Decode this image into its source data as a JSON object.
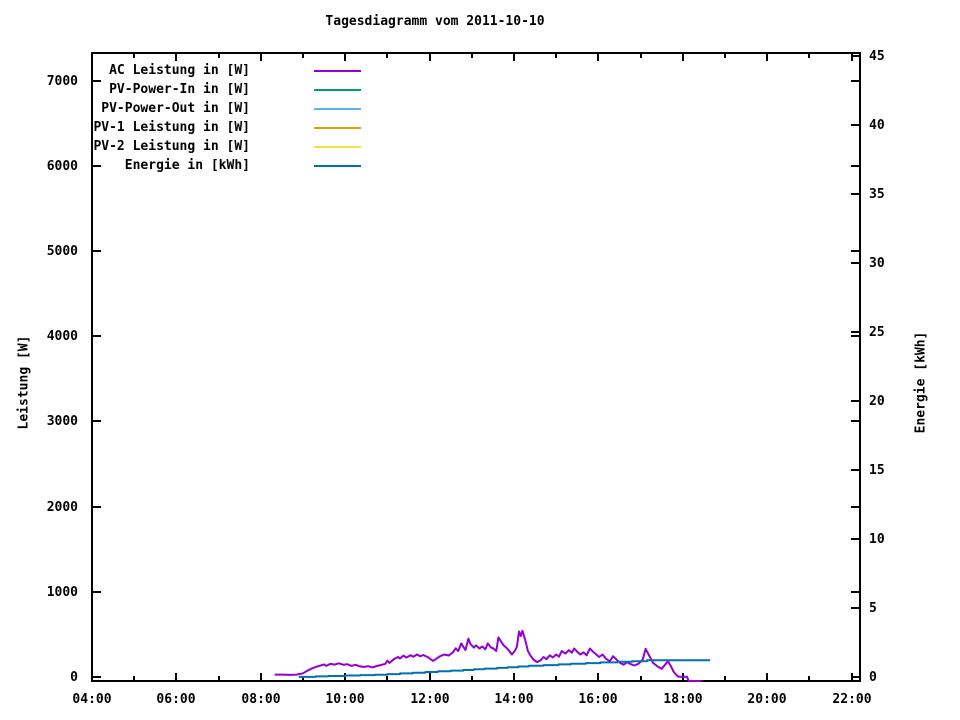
{
  "page": {
    "background": "#ffffff",
    "text_color": "#000000"
  },
  "chart_data": {
    "type": "line",
    "title": "Tagesdiagramm vom 2011-10-10",
    "xlabel": "",
    "ylabel": "Leistung [W]",
    "y2label": "Energie [kWh]",
    "xlim": [
      4,
      22.2
    ],
    "ylim": [
      -50,
      7330
    ],
    "y2lim": [
      -0.3,
      45.2
    ],
    "grid": false,
    "legend_position": "top-left-inside",
    "x_tick_hours": [
      4,
      6,
      8,
      10,
      12,
      14,
      16,
      18,
      20,
      22
    ],
    "x_tick_labels": [
      "04:00",
      "06:00",
      "08:00",
      "10:00",
      "12:00",
      "14:00",
      "16:00",
      "18:00",
      "20:00",
      "22:00"
    ],
    "x_minor_tick_hours": [
      5,
      7,
      9,
      11,
      13,
      15,
      17,
      19,
      21
    ],
    "y_ticks": [
      0,
      1000,
      2000,
      3000,
      4000,
      5000,
      6000,
      7000
    ],
    "y2_ticks": [
      0,
      5,
      10,
      15,
      20,
      25,
      30,
      35,
      40,
      45
    ],
    "series": [
      {
        "name": "AC Leistung in [W]",
        "color": "#9400d3",
        "axis": "y1",
        "step": false,
        "points": [
          [
            8.33,
            25
          ],
          [
            8.5,
            25
          ],
          [
            8.7,
            22
          ],
          [
            8.85,
            25
          ],
          [
            9.0,
            40
          ],
          [
            9.1,
            70
          ],
          [
            9.2,
            95
          ],
          [
            9.3,
            115
          ],
          [
            9.4,
            130
          ],
          [
            9.5,
            145
          ],
          [
            9.55,
            128
          ],
          [
            9.65,
            152
          ],
          [
            9.75,
            143
          ],
          [
            9.85,
            158
          ],
          [
            9.95,
            142
          ],
          [
            10.05,
            148
          ],
          [
            10.15,
            128
          ],
          [
            10.25,
            140
          ],
          [
            10.35,
            122
          ],
          [
            10.45,
            116
          ],
          [
            10.55,
            124
          ],
          [
            10.65,
            110
          ],
          [
            10.75,
            126
          ],
          [
            10.85,
            138
          ],
          [
            10.95,
            152
          ],
          [
            11.0,
            188
          ],
          [
            11.05,
            162
          ],
          [
            11.15,
            205
          ],
          [
            11.25,
            232
          ],
          [
            11.3,
            214
          ],
          [
            11.38,
            248
          ],
          [
            11.45,
            226
          ],
          [
            11.55,
            252
          ],
          [
            11.62,
            236
          ],
          [
            11.7,
            262
          ],
          [
            11.78,
            240
          ],
          [
            11.85,
            256
          ],
          [
            11.95,
            232
          ],
          [
            12.0,
            216
          ],
          [
            12.08,
            186
          ],
          [
            12.15,
            208
          ],
          [
            12.25,
            242
          ],
          [
            12.35,
            262
          ],
          [
            12.45,
            250
          ],
          [
            12.55,
            284
          ],
          [
            12.62,
            334
          ],
          [
            12.68,
            302
          ],
          [
            12.75,
            392
          ],
          [
            12.8,
            352
          ],
          [
            12.85,
            314
          ],
          [
            12.92,
            448
          ],
          [
            12.97,
            384
          ],
          [
            13.05,
            342
          ],
          [
            13.1,
            368
          ],
          [
            13.18,
            332
          ],
          [
            13.25,
            356
          ],
          [
            13.32,
            322
          ],
          [
            13.38,
            392
          ],
          [
            13.45,
            346
          ],
          [
            13.52,
            330
          ],
          [
            13.58,
            302
          ],
          [
            13.63,
            462
          ],
          [
            13.68,
            424
          ],
          [
            13.75,
            372
          ],
          [
            13.82,
            340
          ],
          [
            13.88,
            308
          ],
          [
            13.95,
            262
          ],
          [
            14.02,
            304
          ],
          [
            14.07,
            352
          ],
          [
            14.12,
            532
          ],
          [
            14.16,
            478
          ],
          [
            14.2,
            540
          ],
          [
            14.27,
            424
          ],
          [
            14.33,
            302
          ],
          [
            14.4,
            242
          ],
          [
            14.47,
            198
          ],
          [
            14.55,
            172
          ],
          [
            14.63,
            194
          ],
          [
            14.7,
            232
          ],
          [
            14.77,
            206
          ],
          [
            14.85,
            252
          ],
          [
            14.92,
            226
          ],
          [
            15.0,
            262
          ],
          [
            15.07,
            236
          ],
          [
            15.13,
            302
          ],
          [
            15.22,
            272
          ],
          [
            15.3,
            312
          ],
          [
            15.37,
            282
          ],
          [
            15.43,
            332
          ],
          [
            15.5,
            292
          ],
          [
            15.57,
            262
          ],
          [
            15.65,
            286
          ],
          [
            15.72,
            252
          ],
          [
            15.8,
            332
          ],
          [
            15.87,
            296
          ],
          [
            15.95,
            262
          ],
          [
            16.02,
            232
          ],
          [
            16.1,
            262
          ],
          [
            16.18,
            212
          ],
          [
            16.27,
            182
          ],
          [
            16.35,
            242
          ],
          [
            16.43,
            202
          ],
          [
            16.52,
            162
          ],
          [
            16.6,
            142
          ],
          [
            16.68,
            172
          ],
          [
            16.75,
            152
          ],
          [
            16.85,
            132
          ],
          [
            16.95,
            152
          ],
          [
            17.05,
            202
          ],
          [
            17.12,
            328
          ],
          [
            17.2,
            252
          ],
          [
            17.3,
            162
          ],
          [
            17.4,
            122
          ],
          [
            17.5,
            92
          ],
          [
            17.58,
            142
          ],
          [
            17.65,
            182
          ],
          [
            17.72,
            122
          ],
          [
            17.78,
            62
          ],
          [
            17.85,
            20
          ],
          [
            17.9,
            0
          ],
          [
            18.1,
            0
          ],
          [
            18.14,
            -50
          ],
          [
            18.45,
            -50
          ]
        ]
      },
      {
        "name": "PV-Power-In in [W]",
        "color": "#009e73",
        "axis": "y1",
        "step": false,
        "points": []
      },
      {
        "name": "PV-Power-Out in [W]",
        "color": "#56b4e9",
        "axis": "y1",
        "step": false,
        "points": []
      },
      {
        "name": "PV-1 Leistung in [W]",
        "color": "#e69f00",
        "axis": "y1",
        "step": false,
        "points": []
      },
      {
        "name": "PV-2 Leistung in [W]",
        "color": "#f0e442",
        "axis": "y1",
        "step": false,
        "points": []
      },
      {
        "name": "Energie in [kWh]",
        "color": "#0072b2",
        "axis": "y2",
        "step": true,
        "points": [
          [
            8.9,
            0
          ],
          [
            9.3,
            0.03
          ],
          [
            9.6,
            0.06
          ],
          [
            10.0,
            0.1
          ],
          [
            10.35,
            0.13
          ],
          [
            10.7,
            0.16
          ],
          [
            11.0,
            0.2
          ],
          [
            11.3,
            0.25
          ],
          [
            11.6,
            0.3
          ],
          [
            11.9,
            0.35
          ],
          [
            12.2,
            0.4
          ],
          [
            12.5,
            0.45
          ],
          [
            12.8,
            0.5
          ],
          [
            13.05,
            0.55
          ],
          [
            13.3,
            0.6
          ],
          [
            13.6,
            0.65
          ],
          [
            13.85,
            0.7
          ],
          [
            14.1,
            0.75
          ],
          [
            14.35,
            0.8
          ],
          [
            14.7,
            0.85
          ],
          [
            15.05,
            0.9
          ],
          [
            15.35,
            0.95
          ],
          [
            15.7,
            1.0
          ],
          [
            16.05,
            1.05
          ],
          [
            16.45,
            1.1
          ],
          [
            16.8,
            1.13
          ],
          [
            17.15,
            1.2
          ],
          [
            18.65,
            1.2
          ]
        ]
      }
    ]
  }
}
